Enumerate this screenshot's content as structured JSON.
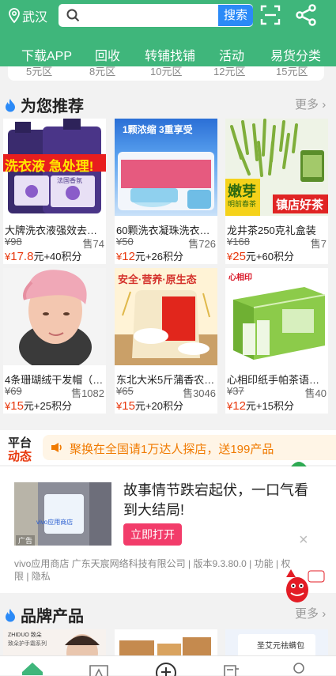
{
  "header": {
    "location": "武汉",
    "search_placeholder": "",
    "search_button": "搜索",
    "nav": [
      "下载APP",
      "回收",
      "转铺找铺",
      "活动",
      "易货分类"
    ],
    "tiers": [
      "5元区",
      "8元区",
      "10元区",
      "12元区",
      "15元区"
    ]
  },
  "recommend": {
    "title": "为您推荐",
    "more": "更多",
    "products": [
      {
        "name": "大牌洗衣液强效去污…",
        "old_price": "¥98",
        "sold": "售74",
        "price_symbol": "¥",
        "price": "17.8",
        "suffix": "元+40积分",
        "banner": "洗衣液 急处理!",
        "bottle": "法国香氛"
      },
      {
        "name": "60颗洗衣凝珠洗衣液…",
        "old_price": "¥50",
        "sold": "售726",
        "price_symbol": "¥",
        "price": "12",
        "suffix": "元+26积分",
        "banner": "1颗浓缩 3重享受"
      },
      {
        "name": "龙井茶250克礼盒装",
        "old_price": "¥168",
        "sold": "售7",
        "price_symbol": "¥",
        "price": "25",
        "suffix": "元+60积分",
        "banner1": "嫩芽",
        "banner1b": "明前春茶",
        "banner2": "镇店好茶"
      },
      {
        "name": "4条珊瑚绒干发帽（…",
        "old_price": "¥69",
        "sold": "售1082",
        "price_symbol": "¥",
        "price": "15",
        "suffix": "元+25积分"
      },
      {
        "name": "东北大米5斤蒲香农…",
        "old_price": "¥65",
        "sold": "售3046",
        "price_symbol": "¥",
        "price": "15",
        "suffix": "元+20积分",
        "banner": "安全·营养·原生态"
      },
      {
        "name": "心相印纸手帕茶语丝…",
        "old_price": "¥37",
        "sold": "售40",
        "price_symbol": "¥",
        "price": "12",
        "suffix": "元+15积分",
        "brand": "心相印"
      }
    ]
  },
  "notice": {
    "label1": "平台",
    "label2": "动态",
    "message": "聚换在全国请1万达人探店，送199产品"
  },
  "ad": {
    "thumb_text": "vivo应用商店",
    "tag": "广告",
    "headline": "故事情节跌宕起伏，一口气看到大结局!",
    "open_button": "立即打开",
    "close": "×",
    "meta": "vivo应用商店 广东天宸网络科技有限公司 | 版本9.3.80.0 | 功能 | 权限 | 隐私"
  },
  "brands": {
    "title": "品牌产品",
    "more": "更多",
    "cards": [
      {
        "label1": "ZHIDUO 致朵",
        "label2": "致朵护手霜系列"
      },
      {
        "label1": ""
      },
      {
        "label1": "圣艾元祛螨包"
      }
    ]
  },
  "colors": {
    "brand_green": "#3fb67b",
    "price_red": "#e8380d",
    "notice_orange": "#f07a00",
    "open_pink": "#f23c6a",
    "search_blue": "#2b8af7"
  },
  "icons": [
    "location-pin-icon",
    "search-icon",
    "scan-icon",
    "share-icon",
    "flame-icon",
    "speaker-icon",
    "chevron-right-icon",
    "home-icon",
    "category-icon",
    "plus-circle-icon",
    "orders-icon",
    "profile-icon"
  ]
}
